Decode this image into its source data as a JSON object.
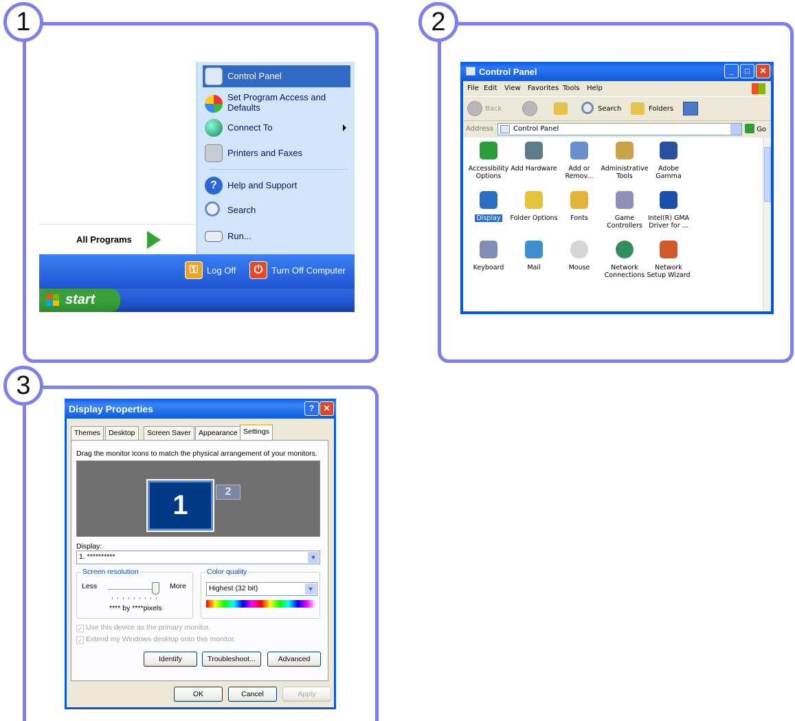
{
  "steps": [
    "1",
    "2",
    "3"
  ],
  "start_menu": {
    "items": [
      {
        "label": "Control Panel",
        "icon": "control-panel-icon",
        "selected": true
      },
      {
        "label": "Set Program Access and\nDefaults",
        "icon": "program-access-icon"
      },
      {
        "label": "Connect To",
        "icon": "connect-to-icon",
        "submenu": true
      },
      {
        "label": "Printers and Faxes",
        "icon": "printer-icon"
      },
      {
        "label": "Help and Support",
        "icon": "help-icon"
      },
      {
        "label": "Search",
        "icon": "search-icon"
      },
      {
        "label": "Run...",
        "icon": "run-icon"
      }
    ],
    "all_programs": "All Programs",
    "log_off": "Log Off",
    "turn_off": "Turn Off Computer",
    "start": "start"
  },
  "control_panel": {
    "title": "Control Panel",
    "menu": [
      "File",
      "Edit",
      "View",
      "Favorites",
      "Tools",
      "Help"
    ],
    "toolbar": {
      "back": "Back",
      "search": "Search",
      "folders": "Folders"
    },
    "address_label": "Address",
    "address_value": "Control Panel",
    "go": "Go",
    "icons": [
      {
        "label": "Accessibility Options",
        "icon": "accessibility-icon",
        "color": "#2a9d3a"
      },
      {
        "label": "Add Hardware",
        "icon": "add-hardware-icon",
        "color": "#5f7c8a"
      },
      {
        "label": "Add or Remov...",
        "icon": "add-remove-programs-icon",
        "color": "#6a8fd0"
      },
      {
        "label": "Administrative Tools",
        "icon": "administrative-tools-icon",
        "color": "#c9a24a"
      },
      {
        "label": "Adobe Gamma",
        "icon": "adobe-gamma-icon",
        "color": "#2a4f9e"
      },
      {
        "label": "Display",
        "icon": "display-icon",
        "color": "#2c6fc0",
        "selected": true
      },
      {
        "label": "Folder Options",
        "icon": "folder-options-icon",
        "color": "#e6c23a"
      },
      {
        "label": "Fonts",
        "icon": "fonts-icon",
        "color": "#e3b43a"
      },
      {
        "label": "Game Controllers",
        "icon": "game-controllers-icon",
        "color": "#8f8fb8"
      },
      {
        "label": "Intel(R) GMA Driver for ...",
        "icon": "intel-gma-icon",
        "color": "#1b4fa8"
      },
      {
        "label": "Keyboard",
        "icon": "keyboard-icon",
        "color": "#7f8fb3"
      },
      {
        "label": "Mail",
        "icon": "mail-icon",
        "color": "#3d8fcf"
      },
      {
        "label": "Mouse",
        "icon": "mouse-icon",
        "color": "#d6d6d6"
      },
      {
        "label": "Network Connections",
        "icon": "network-connections-icon",
        "color": "#2f8f5f"
      },
      {
        "label": "Network Setup Wizard",
        "icon": "network-setup-wizard-icon",
        "color": "#d05a2a"
      }
    ]
  },
  "display_properties": {
    "title": "Display Properties",
    "tabs": [
      "Themes",
      "Desktop",
      "Screen Saver",
      "Appearance",
      "Settings"
    ],
    "instruction": "Drag the monitor icons to match the physical arrangement of your monitors.",
    "monitor1": "1",
    "monitor2": "2",
    "display_label": "Display:",
    "display_value": "1. **********",
    "screen_resolution": "Screen resolution",
    "less": "Less",
    "more": "More",
    "resolution_value": "**** by ****pixels",
    "color_quality": "Color quality",
    "color_value": "Highest (32 bit)",
    "checkbox1": "Use this device as the primary monitor.",
    "checkbox2": "Extend my Windows desktop onto this monitor.",
    "identify": "Identify",
    "troubleshoot": "Troubleshoot...",
    "advanced": "Advanced",
    "ok": "OK",
    "cancel": "Cancel",
    "apply": "Apply"
  }
}
